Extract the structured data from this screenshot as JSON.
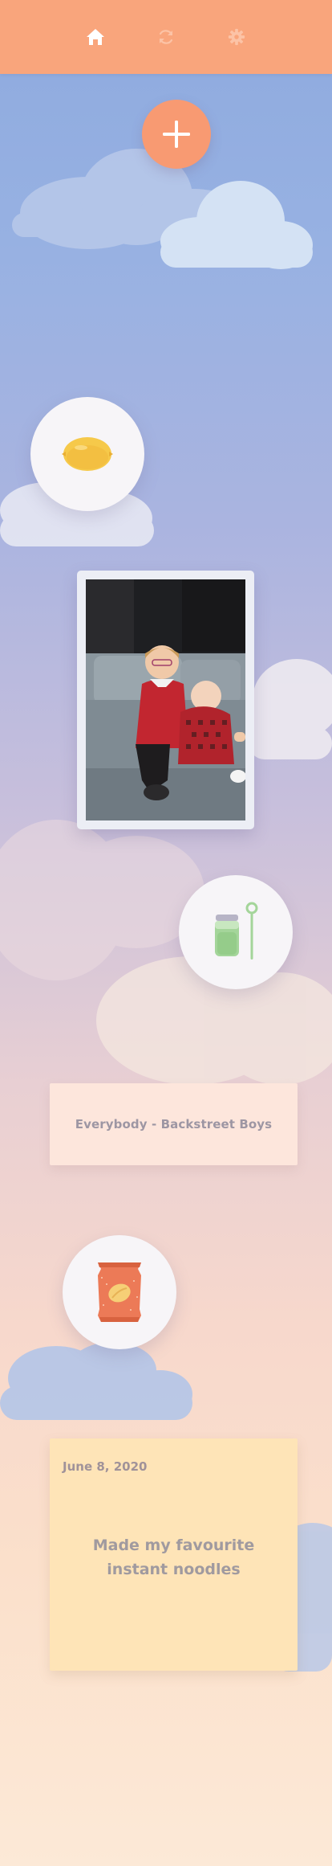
{
  "nav": {
    "home_icon": "home-icon",
    "refresh_icon": "refresh-icon",
    "settings_icon": "gear-icon"
  },
  "colors": {
    "topbar": "#f9a57c",
    "accent": "#f89a72",
    "song_card": "#fde6dc",
    "note_card": "#fee4b7"
  },
  "add_button": {
    "icon": "plus-icon"
  },
  "timeline": {
    "items": [
      {
        "type": "icon",
        "icon": "lemon-icon"
      },
      {
        "type": "photo",
        "icon": "photo-children"
      },
      {
        "type": "icon",
        "icon": "bubble-jar-icon"
      },
      {
        "type": "song",
        "text": "Everybody - Backstreet Boys"
      },
      {
        "type": "icon",
        "icon": "chips-bag-icon"
      },
      {
        "type": "note",
        "date": "June 8, 2020",
        "text_line1": "Made my favourite",
        "text_line2": "instant noodles"
      }
    ]
  }
}
